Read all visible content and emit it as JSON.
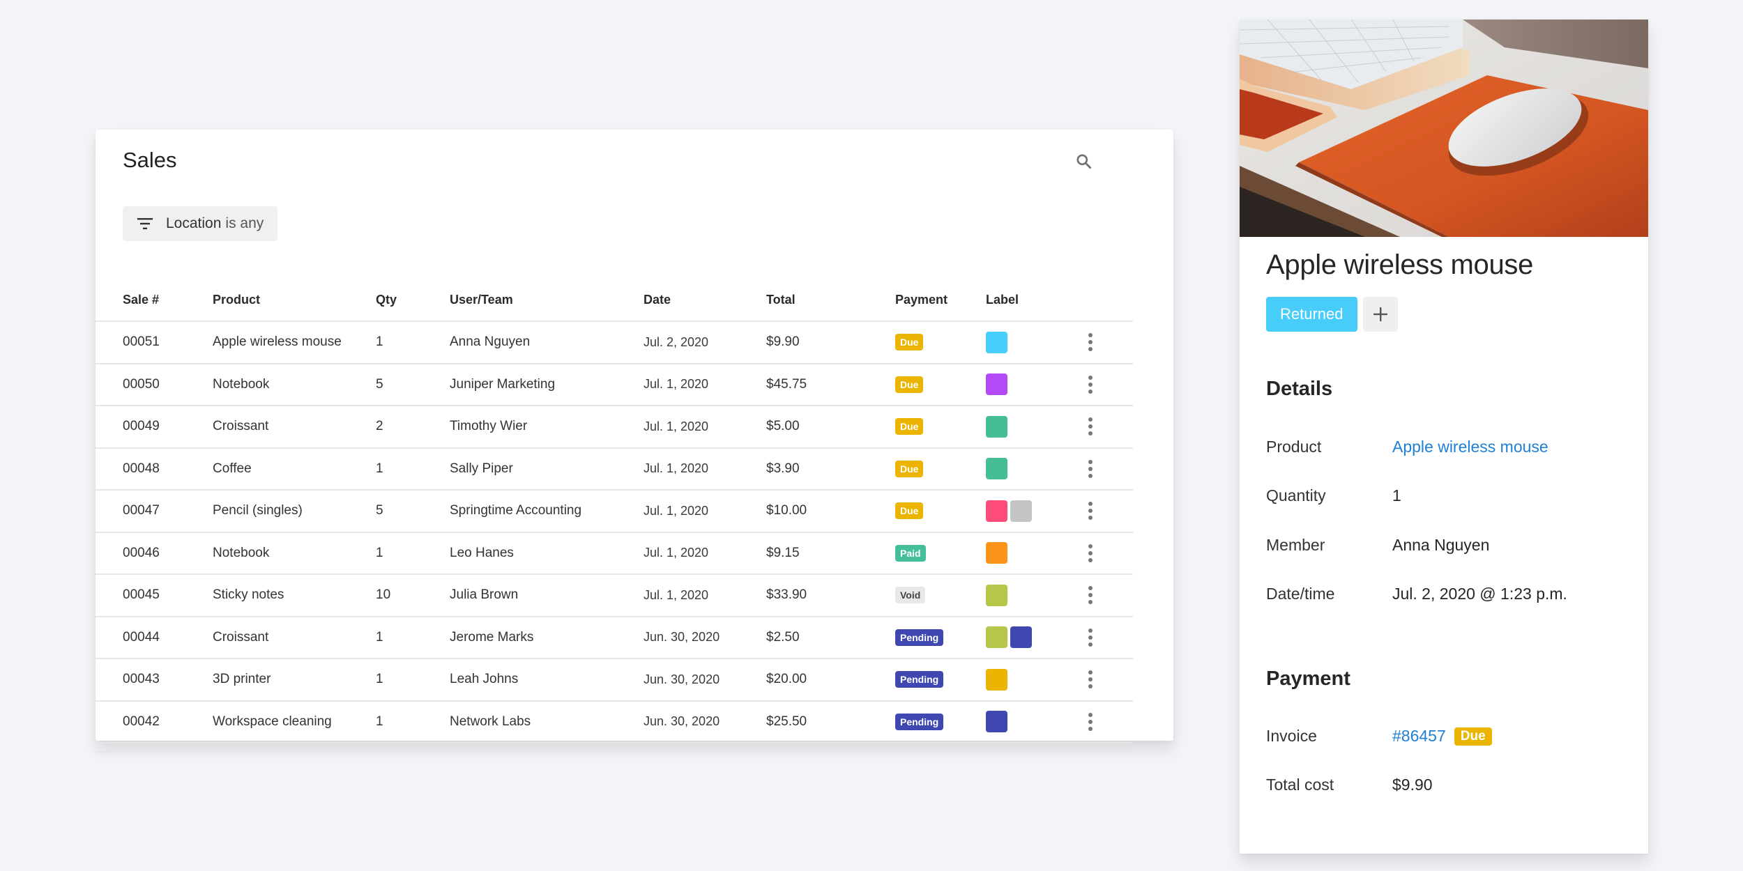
{
  "sales": {
    "title": "Sales",
    "search_icon": "search-icon",
    "filter": {
      "icon": "filter-icon",
      "field": "Location",
      "condition": "is any"
    },
    "columns": [
      "Sale #",
      "Product",
      "Qty",
      "User/Team",
      "Date",
      "Total",
      "Payment",
      "Label"
    ],
    "rows": [
      {
        "sale": "00051",
        "product": "Apple wireless mouse",
        "qty": "1",
        "user": "Anna Nguyen",
        "date": "Jul. 2, 2020",
        "total": "$9.90",
        "payment": "Due",
        "payment_type": "due",
        "labels": [
          "#47cefc"
        ]
      },
      {
        "sale": "00050",
        "product": "Notebook",
        "qty": "5",
        "user": "Juniper Marketing",
        "date": "Jul. 1, 2020",
        "total": "$45.75",
        "payment": "Due",
        "payment_type": "due",
        "labels": [
          "#b44af7"
        ]
      },
      {
        "sale": "00049",
        "product": "Croissant",
        "qty": "2",
        "user": "Timothy Wier",
        "date": "Jul. 1, 2020",
        "total": "$5.00",
        "payment": "Due",
        "payment_type": "due",
        "labels": [
          "#45be98"
        ]
      },
      {
        "sale": "00048",
        "product": "Coffee",
        "qty": "1",
        "user": "Sally Piper",
        "date": "Jul. 1, 2020",
        "total": "$3.90",
        "payment": "Due",
        "payment_type": "due",
        "labels": [
          "#45be98"
        ]
      },
      {
        "sale": "00047",
        "product": "Pencil (singles)",
        "qty": "5",
        "user": "Springtime Accounting",
        "date": "Jul. 1, 2020",
        "total": "$10.00",
        "payment": "Due",
        "payment_type": "due",
        "labels": [
          "#fc4c77",
          "#c4c4c4"
        ]
      },
      {
        "sale": "00046",
        "product": "Notebook",
        "qty": "1",
        "user": "Leo Hanes",
        "date": "Jul. 1, 2020",
        "total": "$9.15",
        "payment": "Paid",
        "payment_type": "paid",
        "labels": [
          "#fb9419"
        ]
      },
      {
        "sale": "00045",
        "product": "Sticky notes",
        "qty": "10",
        "user": "Julia Brown",
        "date": "Jul. 1, 2020",
        "total": "$33.90",
        "payment": "Void",
        "payment_type": "void",
        "labels": [
          "#b5c64a"
        ]
      },
      {
        "sale": "00044",
        "product": "Croissant",
        "qty": "1",
        "user": "Jerome Marks",
        "date": "Jun. 30, 2020",
        "total": "$2.50",
        "payment": "Pending",
        "payment_type": "pending",
        "labels": [
          "#b5c64a",
          "#3f47b1"
        ]
      },
      {
        "sale": "00043",
        "product": "3D printer",
        "qty": "1",
        "user": "Leah Johns",
        "date": "Jun. 30, 2020",
        "total": "$20.00",
        "payment": "Pending",
        "payment_type": "pending",
        "labels": [
          "#ebb400"
        ]
      },
      {
        "sale": "00042",
        "product": "Workspace cleaning",
        "qty": "1",
        "user": "Network Labs",
        "date": "Jun. 30, 2020",
        "total": "$25.50",
        "payment": "Pending",
        "payment_type": "pending",
        "labels": [
          "#3f47b1"
        ]
      }
    ]
  },
  "detail": {
    "image_alt": "Apple wireless mouse on orange leather mouse pad next to keyboard",
    "title": "Apple wireless mouse",
    "tag": "Returned",
    "add_tag_icon": "plus-icon",
    "details_heading": "Details",
    "details": {
      "product_label": "Product",
      "product_value": "Apple wireless mouse",
      "quantity_label": "Quantity",
      "quantity_value": "1",
      "member_label": "Member",
      "member_value": "Anna Nguyen",
      "datetime_label": "Date/time",
      "datetime_value": "Jul. 2, 2020 @ 1:23 p.m."
    },
    "payment_heading": "Payment",
    "payment": {
      "invoice_label": "Invoice",
      "invoice_value": "#86457",
      "invoice_status": "Due",
      "total_label": "Total cost",
      "total_value": "$9.90"
    }
  },
  "colors": {
    "background": "#f3f4f7",
    "due": "#ebb400",
    "paid": "#44be9b",
    "void": "#e8e8e8",
    "pending": "#3f47b1",
    "returned": "#48cdfb",
    "link": "#1f7fd4"
  }
}
